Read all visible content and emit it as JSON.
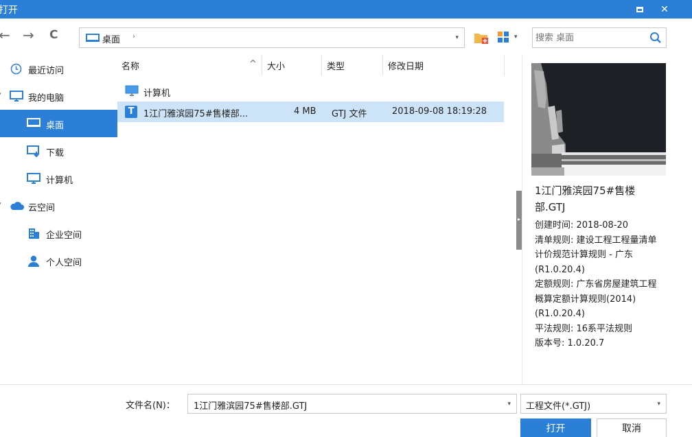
{
  "window": {
    "title": "打开",
    "minimize_glyph": "▬",
    "close_glyph": "✕"
  },
  "toolbar": {
    "back_glyph": "←",
    "forward_glyph": "→",
    "refresh_glyph": "C",
    "address": {
      "crumb": "桌面",
      "sep": "›",
      "dropdown": "▾"
    },
    "search_placeholder": "搜索 桌面",
    "view_dropdown": "▾"
  },
  "sidebar": {
    "items": [
      {
        "label": "最近访问",
        "icon": "clock-icon"
      },
      {
        "label": "我的电脑",
        "icon": "monitor-icon",
        "twisty": "▾"
      },
      {
        "label": "桌面",
        "icon": "desktop-icon",
        "selected": true
      },
      {
        "label": "下载",
        "icon": "download-icon"
      },
      {
        "label": "计算机",
        "icon": "computer-icon"
      },
      {
        "label": "云空间",
        "icon": "cloud-icon",
        "twisty": "▾"
      },
      {
        "label": "企业空间",
        "icon": "building-icon"
      },
      {
        "label": "个人空间",
        "icon": "person-icon"
      }
    ]
  },
  "filelist": {
    "columns": {
      "name": "名称",
      "sort_glyph": "^",
      "size": "大小",
      "type": "类型",
      "modified": "修改日期"
    },
    "rows": [
      {
        "name": "计算机",
        "size": "",
        "type": "",
        "modified": "",
        "icon": "computer-icon"
      },
      {
        "name": "1江门雅滨园75#售楼部...",
        "size": "4 MB",
        "type": "GTJ 文件",
        "modified": "2018-09-08 18:19:28",
        "icon": "gtj-file-icon",
        "badge": "T"
      }
    ]
  },
  "preview": {
    "name": "1江门雅滨园75#售楼部.GTJ",
    "info": [
      "创建时间: 2018-08-20",
      "清单规则: 建设工程工程量清单计价规范计算规则 - 广东(R1.0.20.4)",
      "定额规则: 广东省房屋建筑工程概算定额计算规则(2014)(R1.0.20.4)",
      "平法规则: 16系平法规则",
      "版本号: 1.0.20.7"
    ],
    "splitter_glyph": "▸"
  },
  "bottom": {
    "filename_label": "文件名(N)：",
    "filename_value": "1江门雅滨园75#售楼部.GTJ",
    "filetype_value": "工程文件(*.GTJ)",
    "dropdown": "▾",
    "open_label": "打开",
    "cancel_label": "取消"
  },
  "colors": {
    "accent": "#2b7fd6",
    "selected_row": "#cde3f7"
  }
}
